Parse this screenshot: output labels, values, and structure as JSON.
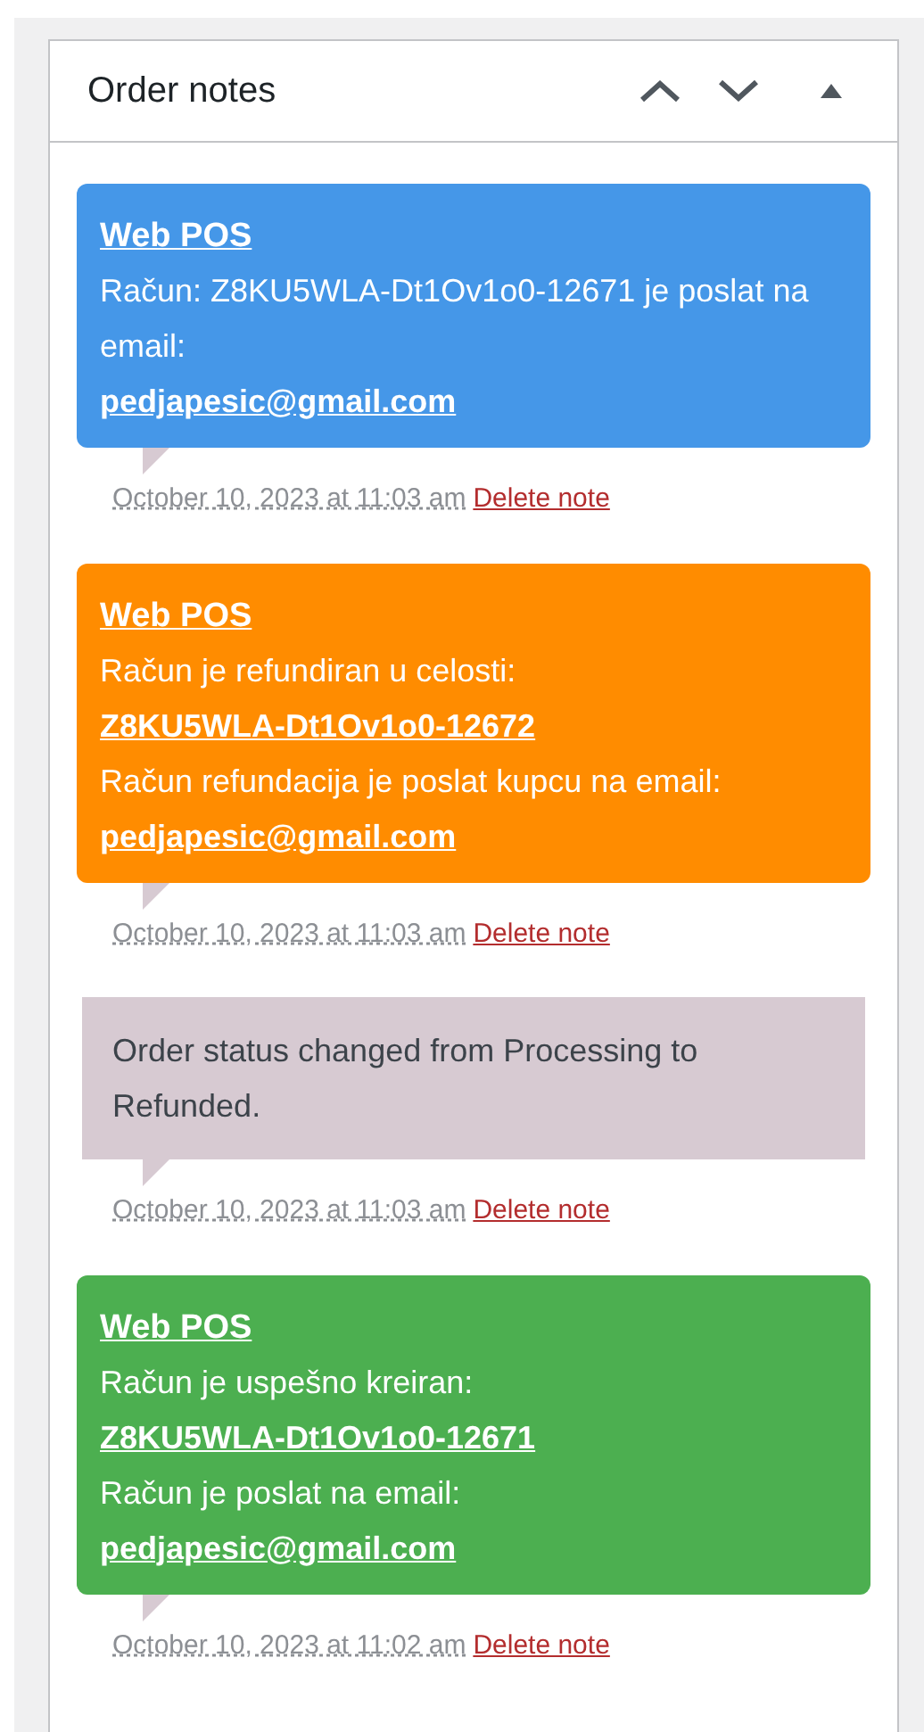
{
  "panel": {
    "title": "Order notes"
  },
  "notes": [
    {
      "kind": "plugin",
      "color": "#4597e8",
      "content": [
        {
          "kind": "link",
          "text": "Web POS"
        },
        {
          "kind": "text",
          "text": "Račun: Z8KU5WLA-Dt1Ov1o0-12671 je poslat na email:"
        },
        {
          "kind": "link",
          "text": "pedjapesic@gmail.com"
        }
      ],
      "date": "October 10, 2023 at 11:03 am",
      "delete": "Delete note"
    },
    {
      "kind": "plugin",
      "color": "#ff8c00",
      "content": [
        {
          "kind": "link",
          "text": "Web POS"
        },
        {
          "kind": "text",
          "text": "Račun je refundiran u celosti:"
        },
        {
          "kind": "link",
          "text": "Z8KU5WLA-Dt1Ov1o0-12672"
        },
        {
          "kind": "text",
          "text": "Račun refundacija je poslat kupcu na email:"
        },
        {
          "kind": "link",
          "text": "pedjapesic@gmail.com"
        }
      ],
      "date": "October 10, 2023 at 11:03 am",
      "delete": "Delete note"
    },
    {
      "kind": "system",
      "color": "#d7cad2",
      "content": [
        {
          "kind": "text",
          "text": "Order status changed from Processing to Refunded."
        }
      ],
      "date": "October 10, 2023 at 11:03 am",
      "delete": "Delete note"
    },
    {
      "kind": "plugin",
      "color": "#4caf50",
      "content": [
        {
          "kind": "link",
          "text": "Web POS"
        },
        {
          "kind": "text",
          "text": "Račun je uspešno kreiran:"
        },
        {
          "kind": "link",
          "text": "Z8KU5WLA-Dt1Ov1o0-12671"
        },
        {
          "kind": "text",
          "text": "Račun je poslat na email:"
        },
        {
          "kind": "link",
          "text": "pedjapesic@gmail.com"
        }
      ],
      "date": "October 10, 2023 at 11:02 am",
      "delete": "Delete note"
    }
  ]
}
